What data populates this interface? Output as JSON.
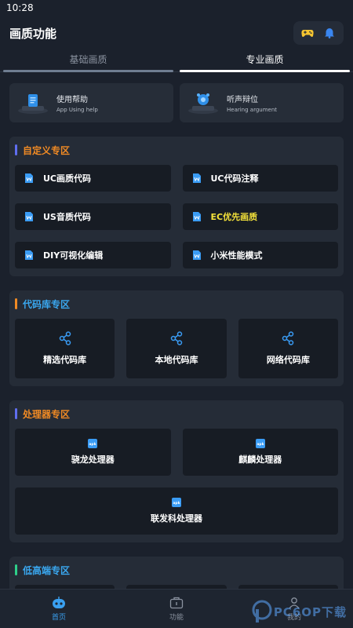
{
  "status_bar": {
    "time": "10:28"
  },
  "header": {
    "title": "画质功能",
    "icons": [
      "gamepad-icon",
      "bell-icon"
    ]
  },
  "tabs": [
    {
      "label": "基础画质",
      "active": false
    },
    {
      "label": "专业画质",
      "active": true
    }
  ],
  "top_cards": [
    {
      "title": "使用帮助",
      "subtitle": "App Using help",
      "icon": "help-doc-icon"
    },
    {
      "title": "听声辩位",
      "subtitle": "Hearing argument",
      "icon": "sound-icon"
    }
  ],
  "sections": {
    "custom": {
      "title": "自定义专区",
      "title_color": "#f08a24",
      "bar_color": "#5f6ef0",
      "items": [
        {
          "label": "UC画质代码",
          "color": "#ffffff"
        },
        {
          "label": "UC代码注释",
          "color": "#ffffff"
        },
        {
          "label": "US音质代码",
          "color": "#ffffff"
        },
        {
          "label": "EC优先画质",
          "color": "#f4e23a"
        },
        {
          "label": "DIY可视化编辑",
          "color": "#ffffff"
        },
        {
          "label": "小米性能模式",
          "color": "#ffffff"
        }
      ]
    },
    "code_library": {
      "title": "代码库专区",
      "title_color": "#3aa8f0",
      "bar_color": "#f08a24",
      "items": [
        "精选代码库",
        "本地代码库",
        "网络代码库"
      ]
    },
    "processor": {
      "title": "处理器专区",
      "title_color": "#f08a24",
      "bar_color": "#5f6ef0",
      "items": [
        "骁龙处理器",
        "麒麟处理器"
      ],
      "full_item": "联发科处理器"
    },
    "low_high": {
      "title": "低高端专区",
      "title_color": "#3aa8f0",
      "bar_color": "#2fd08a"
    }
  },
  "bottom_nav": [
    {
      "label": "首页",
      "icon": "robot-icon",
      "active": true
    },
    {
      "label": "功能",
      "icon": "toolbox-icon",
      "active": false
    },
    {
      "label": "我的",
      "icon": "user-icon",
      "active": false
    }
  ],
  "watermark": {
    "text": "PC6OP下载"
  }
}
